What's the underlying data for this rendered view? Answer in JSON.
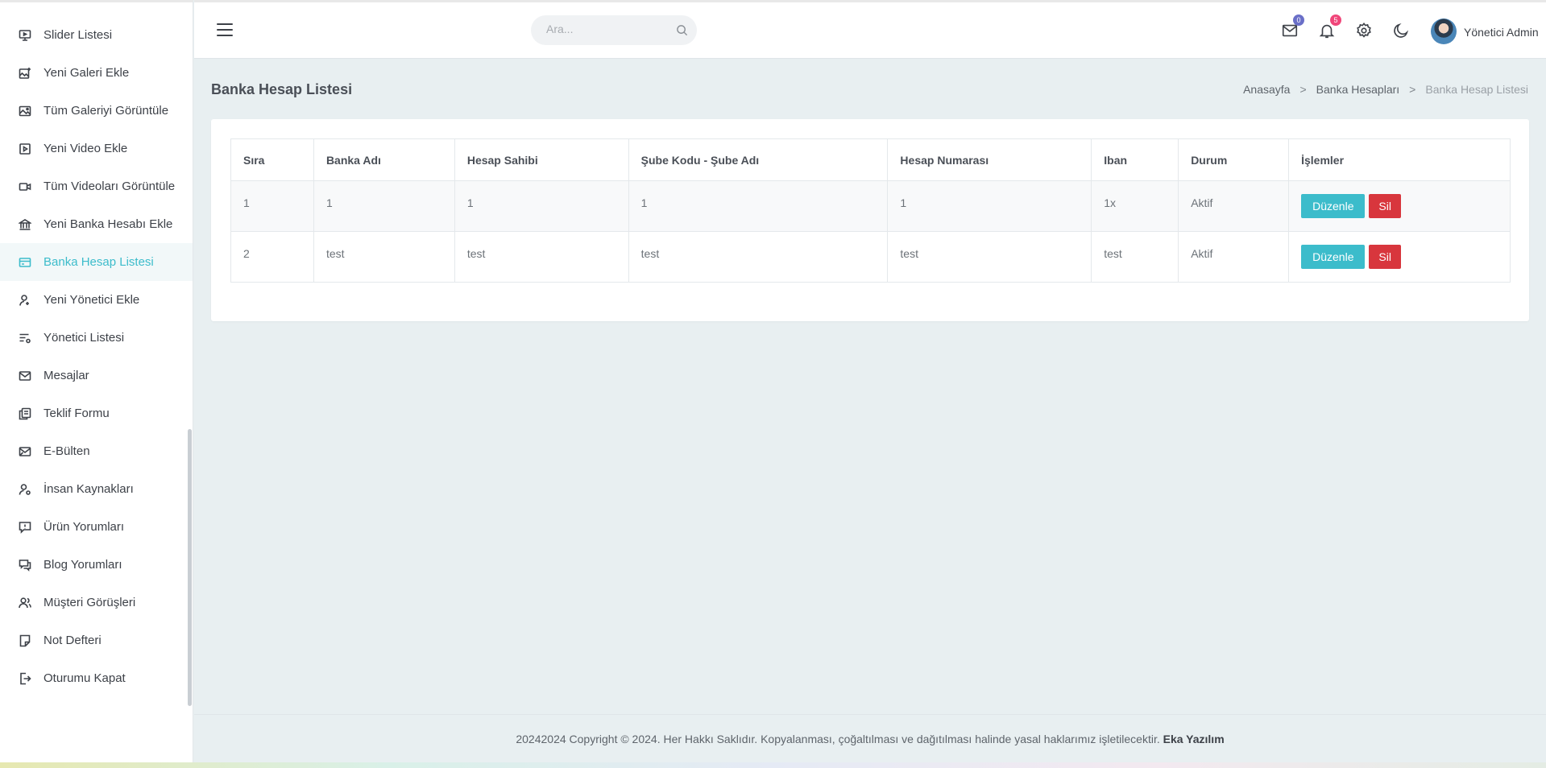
{
  "sidebar": {
    "items": [
      {
        "label": "Slider Listesi",
        "icon": "monitor-icon"
      },
      {
        "label": "Yeni Galeri Ekle",
        "icon": "gallery-add-icon"
      },
      {
        "label": "Tüm Galeriyi Görüntüle",
        "icon": "image-icon"
      },
      {
        "label": "Yeni Video Ekle",
        "icon": "video-play-icon"
      },
      {
        "label": "Tüm Videoları Görüntüle",
        "icon": "video-camera-icon"
      },
      {
        "label": "Yeni Banka Hesabı Ekle",
        "icon": "bank-icon"
      },
      {
        "label": "Banka Hesap Listesi",
        "icon": "card-icon",
        "active": true
      },
      {
        "label": "Yeni Yönetici Ekle",
        "icon": "user-add-icon"
      },
      {
        "label": "Yönetici Listesi",
        "icon": "list-settings-icon"
      },
      {
        "label": "Mesajlar",
        "icon": "mail-icon"
      },
      {
        "label": "Teklif Formu",
        "icon": "copy-icon"
      },
      {
        "label": "E-Bülten",
        "icon": "mail-send-icon"
      },
      {
        "label": "İnsan Kaynakları",
        "icon": "user-settings-icon"
      },
      {
        "label": "Ürün Yorumları",
        "icon": "comment-alert-icon"
      },
      {
        "label": "Blog Yorumları",
        "icon": "comments-icon"
      },
      {
        "label": "Müşteri Görüşleri",
        "icon": "users-icon"
      },
      {
        "label": "Not Defteri",
        "icon": "note-icon"
      },
      {
        "label": "Oturumu Kapat",
        "icon": "logout-icon"
      }
    ]
  },
  "header": {
    "search_placeholder": "Ara...",
    "mail_count": "0",
    "notification_count": "5",
    "user_name": "Yönetici Admin"
  },
  "page": {
    "title": "Banka Hesap Listesi",
    "breadcrumb": [
      "Anasayfa",
      "Banka Hesapları",
      "Banka Hesap Listesi"
    ]
  },
  "table": {
    "headers": [
      "Sıra",
      "Banka Adı",
      "Hesap Sahibi",
      "Şube Kodu - Şube Adı",
      "Hesap Numarası",
      "Iban",
      "Durum",
      "İşlemler"
    ],
    "rows": [
      [
        "1",
        "1",
        "1",
        "1",
        "1",
        "1x",
        "Aktif"
      ],
      [
        "2",
        "test",
        "test",
        "test",
        "test",
        "test",
        "Aktif"
      ]
    ],
    "edit_label": "Düzenle",
    "delete_label": "Sil"
  },
  "footer": {
    "text": "20242024 Copyright © 2024. Her Hakkı Saklıdır. Kopyalanması, çoğaltılması ve dağıtılması halinde yasal haklarımız işletilecektir.",
    "brand": "Eka Yazılım"
  },
  "colors": {
    "accent": "#3cbccb",
    "danger": "#d8363d",
    "mail_badge": "#6a6fc8",
    "notification_badge": "#f0467a"
  }
}
